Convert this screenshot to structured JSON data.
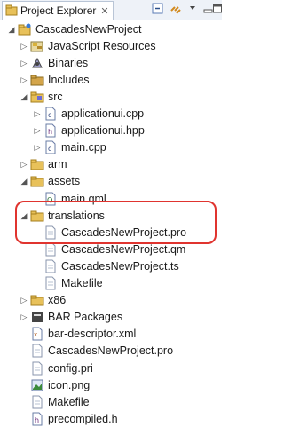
{
  "view": {
    "title": "Project Explorer",
    "close": "✕"
  },
  "tree": [
    {
      "label": "CascadesNewProject",
      "icon": "project-folder-icon",
      "depth": 0,
      "expanded": true
    },
    {
      "label": "JavaScript Resources",
      "icon": "js-resources-icon",
      "depth": 1,
      "expanded": false
    },
    {
      "label": "Binaries",
      "icon": "binaries-icon",
      "depth": 1,
      "expanded": false
    },
    {
      "label": "Includes",
      "icon": "includes-icon",
      "depth": 1,
      "expanded": false
    },
    {
      "label": "src",
      "icon": "source-folder-icon",
      "depth": 1,
      "expanded": true
    },
    {
      "label": "applicationui.cpp",
      "icon": "cpp-file-icon",
      "depth": 2,
      "expanded": false
    },
    {
      "label": "applicationui.hpp",
      "icon": "header-file-icon",
      "depth": 2,
      "expanded": false
    },
    {
      "label": "main.cpp",
      "icon": "cpp-file-icon",
      "depth": 2,
      "expanded": false
    },
    {
      "label": "arm",
      "icon": "folder-icon",
      "depth": 1,
      "expanded": false
    },
    {
      "label": "assets",
      "icon": "folder-icon",
      "depth": 1,
      "expanded": true
    },
    {
      "label": "main.qml",
      "icon": "qml-file-icon",
      "depth": 2,
      "expanded": null
    },
    {
      "label": "translations",
      "icon": "folder-icon",
      "depth": 1,
      "expanded": true
    },
    {
      "label": "CascadesNewProject.pro",
      "icon": "file-icon",
      "depth": 2,
      "expanded": null
    },
    {
      "label": "CascadesNewProject.qm",
      "icon": "file-icon",
      "depth": 2,
      "expanded": null
    },
    {
      "label": "CascadesNewProject.ts",
      "icon": "file-icon",
      "depth": 2,
      "expanded": null
    },
    {
      "label": "Makefile",
      "icon": "file-icon",
      "depth": 2,
      "expanded": null
    },
    {
      "label": "x86",
      "icon": "folder-icon",
      "depth": 1,
      "expanded": false
    },
    {
      "label": "BAR Packages",
      "icon": "bar-packages-icon",
      "depth": 1,
      "expanded": false
    },
    {
      "label": "bar-descriptor.xml",
      "icon": "xml-file-icon",
      "depth": 1,
      "expanded": null
    },
    {
      "label": "CascadesNewProject.pro",
      "icon": "file-icon",
      "depth": 1,
      "expanded": null
    },
    {
      "label": "config.pri",
      "icon": "file-icon",
      "depth": 1,
      "expanded": null
    },
    {
      "label": "icon.png",
      "icon": "image-file-icon",
      "depth": 1,
      "expanded": null
    },
    {
      "label": "Makefile",
      "icon": "file-icon",
      "depth": 1,
      "expanded": null
    },
    {
      "label": "precompiled.h",
      "icon": "header-file-icon",
      "depth": 1,
      "expanded": null
    }
  ],
  "colors": {
    "highlight": "#e0342f",
    "folder": "#e8c15a"
  }
}
